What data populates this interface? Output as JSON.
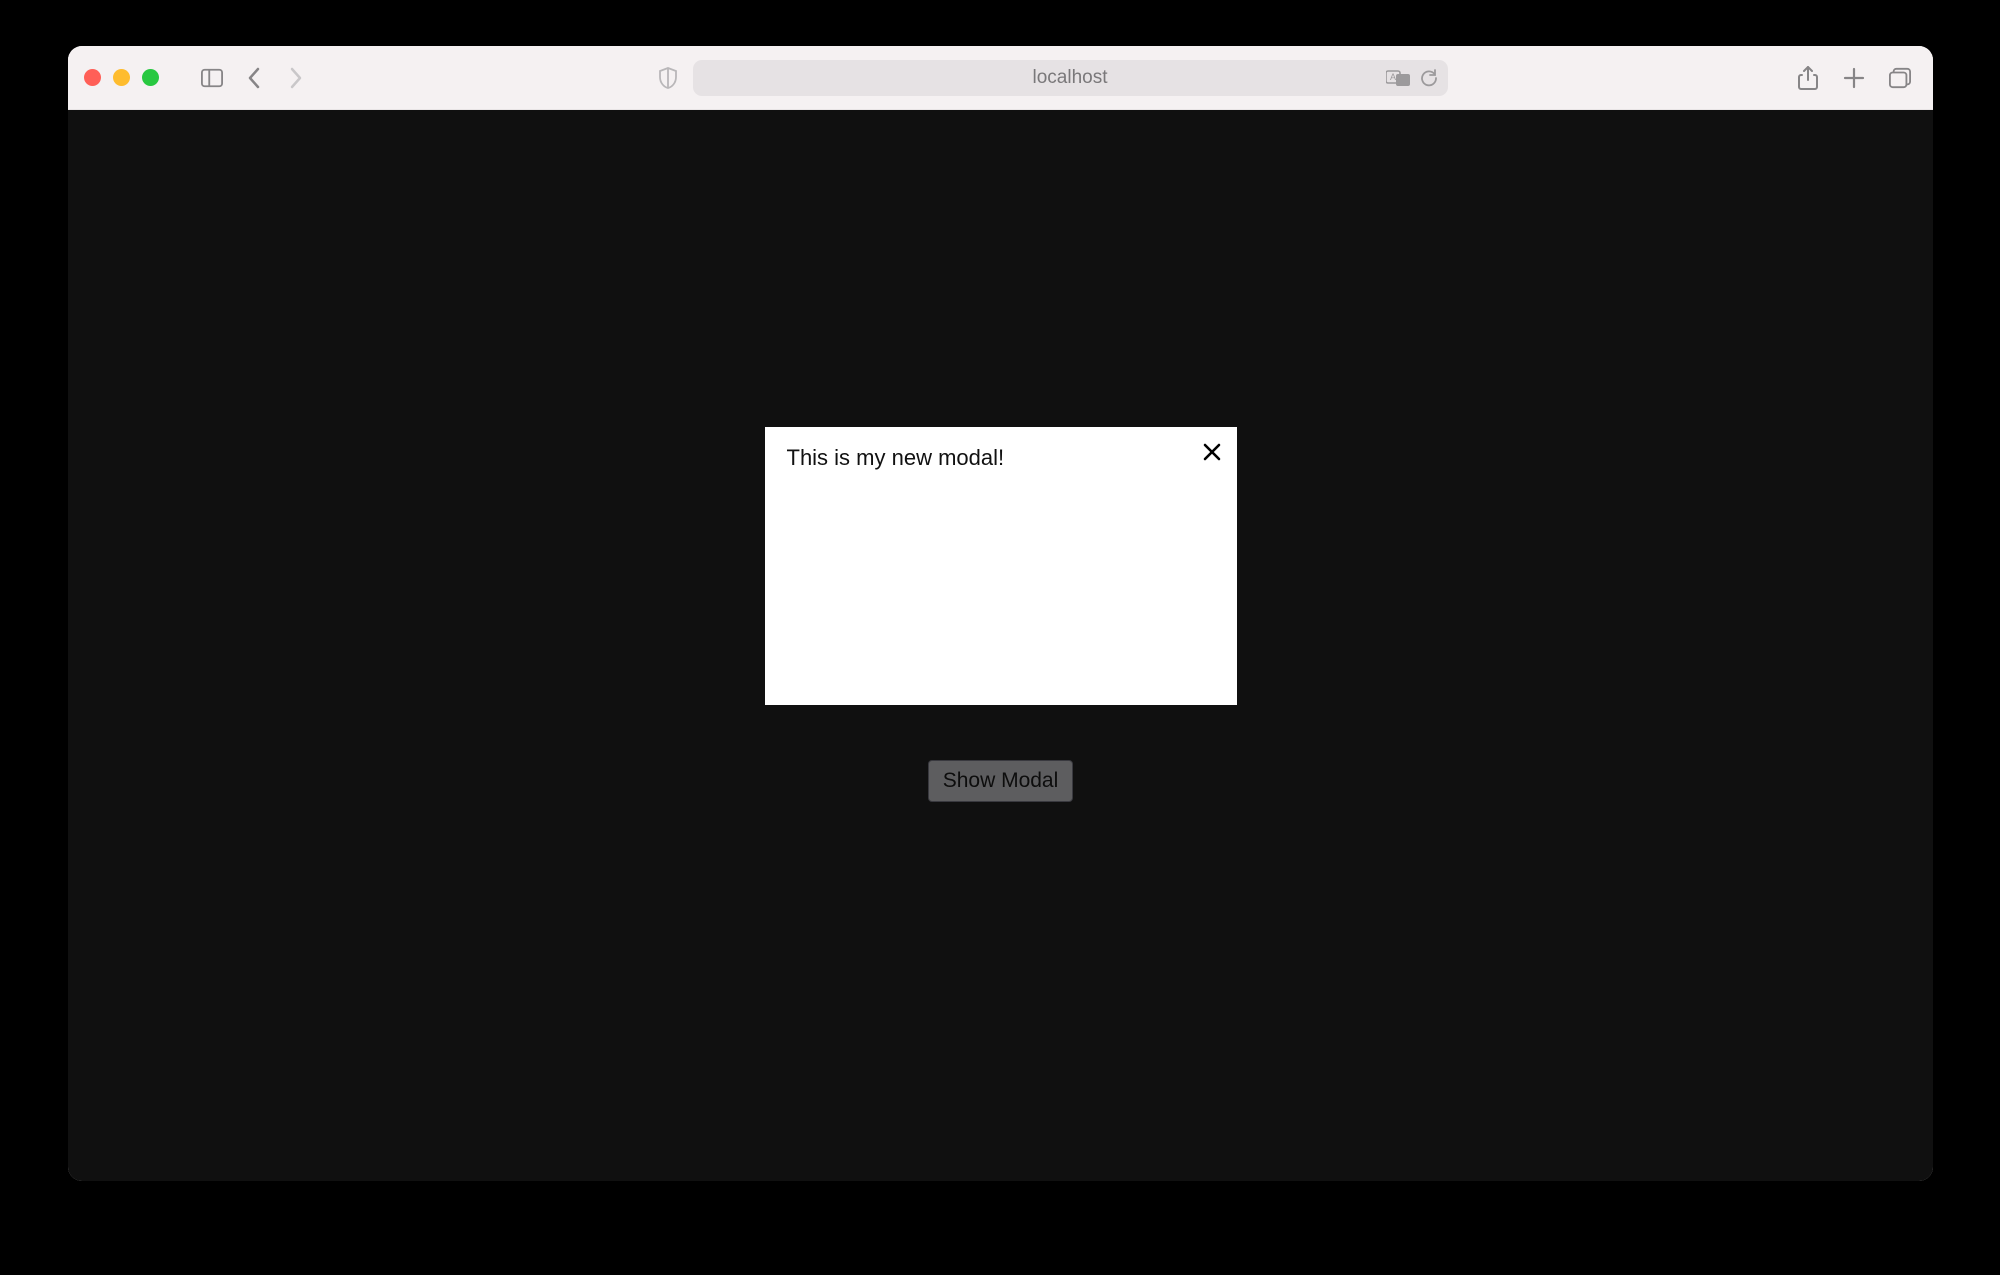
{
  "browser": {
    "address": "localhost"
  },
  "page": {
    "show_modal_label": "Show Modal",
    "logo_color": "#2b7489"
  },
  "modal": {
    "text": "This is my new modal!"
  }
}
